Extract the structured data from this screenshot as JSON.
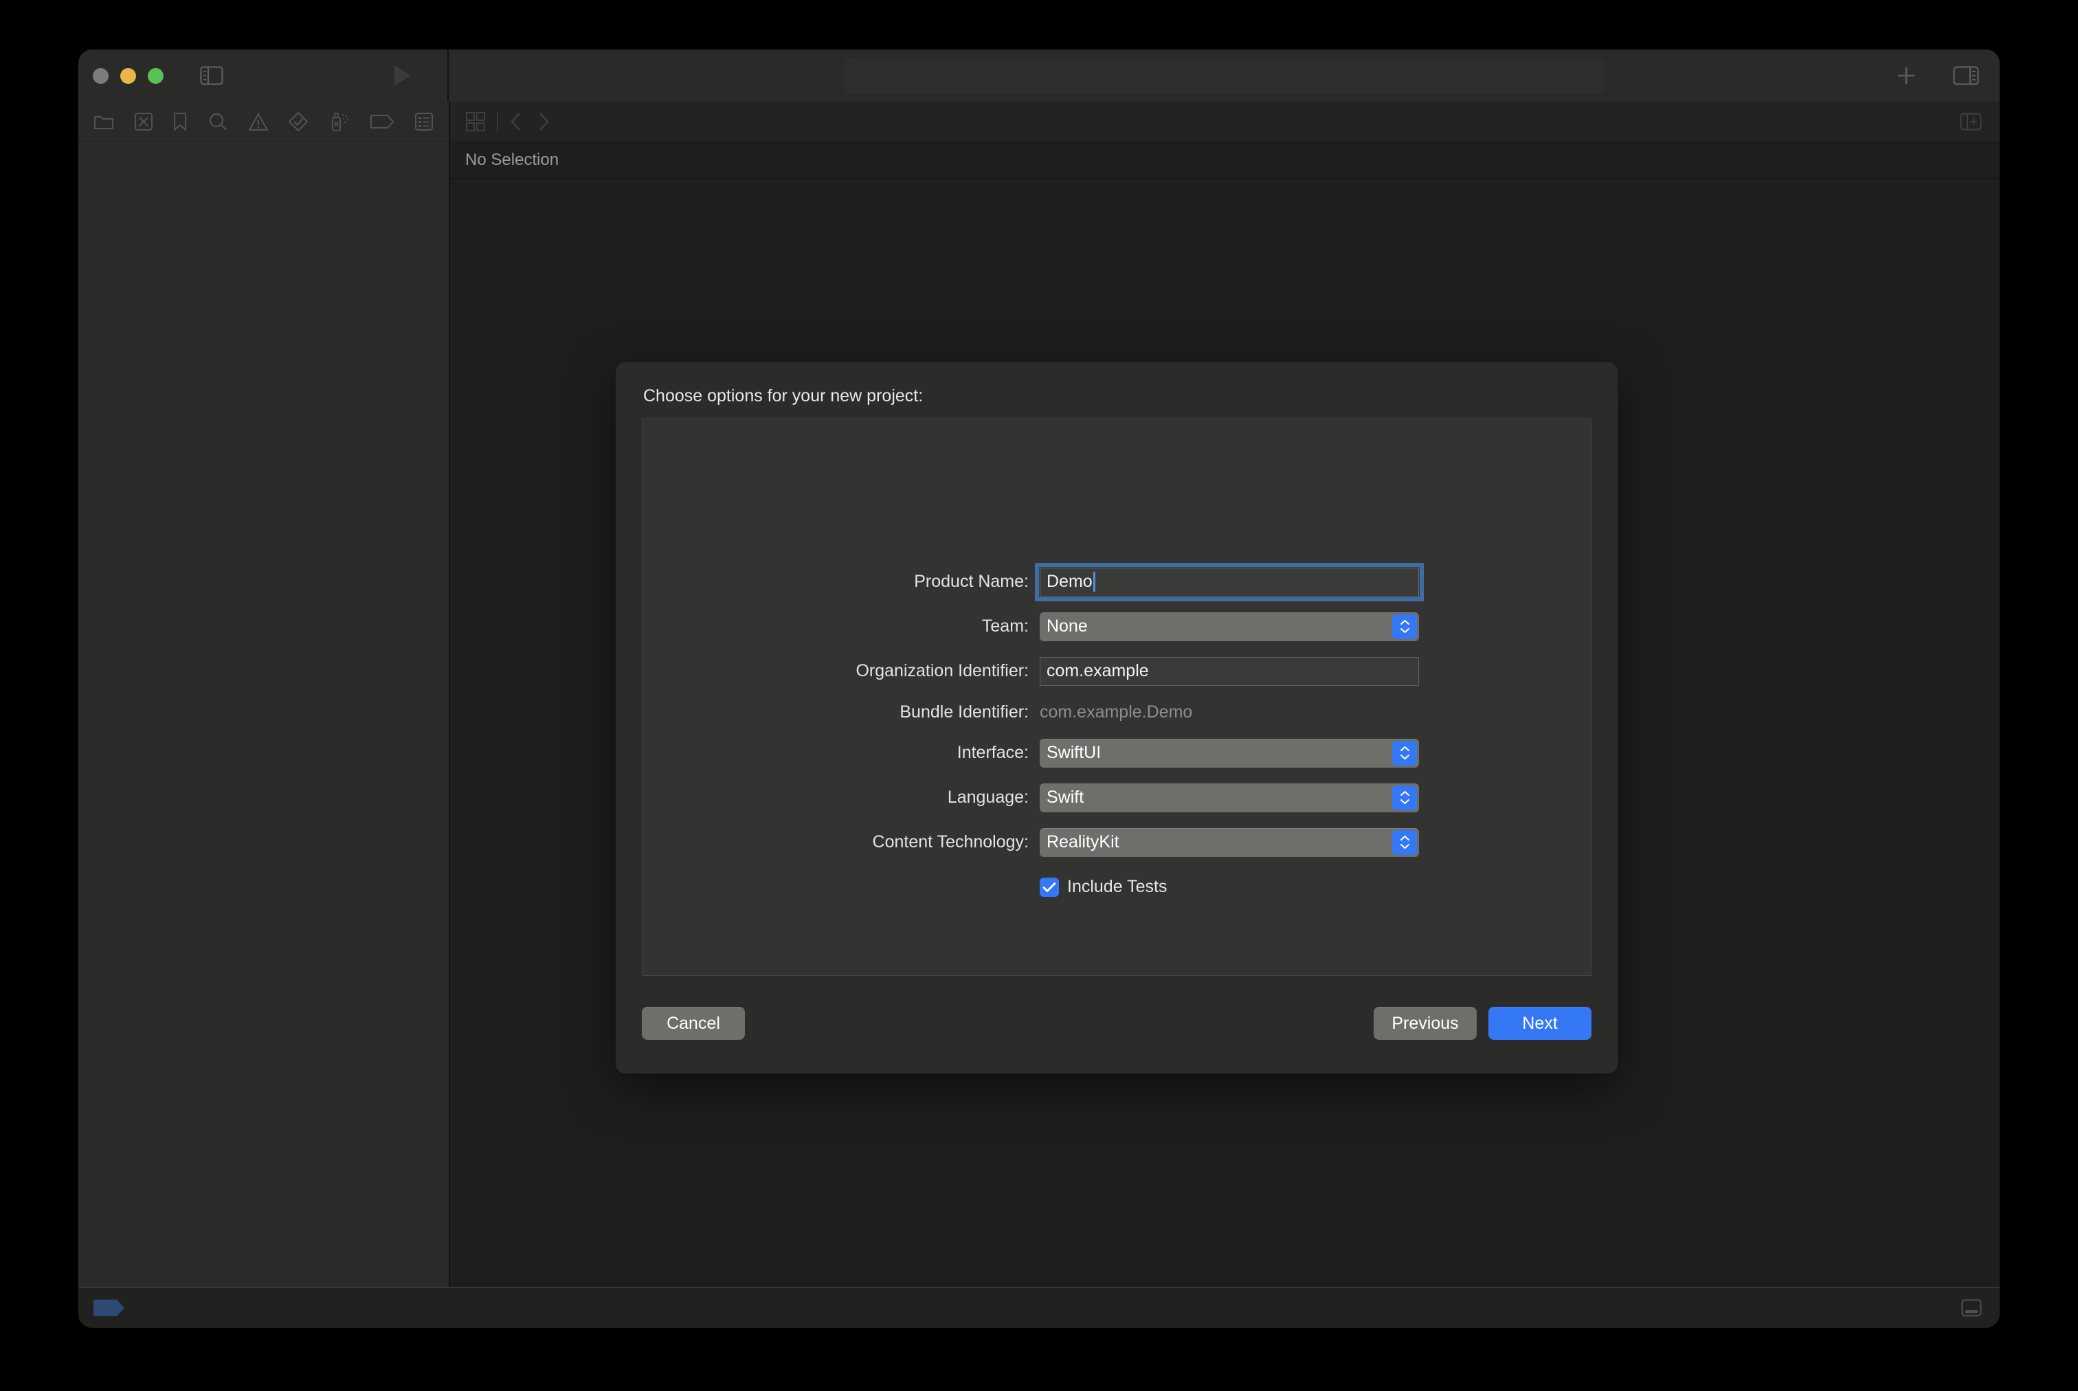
{
  "app": {
    "name": "Xcode",
    "accent_color": "#3478f6",
    "window_bg": "#1e1f1c",
    "sidebar_bg": "#2a2a28",
    "sheet_bg": "#2b2c29"
  },
  "titlebar": {
    "traffic_lights": [
      {
        "name": "close",
        "color": "#7c7c7a"
      },
      {
        "name": "minimize",
        "color": "#e9b64a"
      },
      {
        "name": "zoom",
        "color": "#5bbf54"
      }
    ],
    "sidebar_toggle_icon": "sidebar-left-icon",
    "run_icon": "run-play-icon",
    "activity_text": "",
    "add_icon": "plus-icon",
    "inspector_toggle_icon": "sidebar-right-icon"
  },
  "navigator": {
    "tabs": [
      {
        "icon": "folder-icon",
        "label": "Project navigator"
      },
      {
        "icon": "source-control-icon",
        "label": "Source control navigator"
      },
      {
        "icon": "bookmark-icon",
        "label": "Bookmark navigator"
      },
      {
        "icon": "search-icon",
        "label": "Find navigator"
      },
      {
        "icon": "warning-triangle-icon",
        "label": "Issue navigator"
      },
      {
        "icon": "test-diamond-icon",
        "label": "Test navigator"
      },
      {
        "icon": "debug-spray-icon",
        "label": "Debug navigator"
      },
      {
        "icon": "breakpoint-tag-icon",
        "label": "Breakpoint navigator"
      },
      {
        "icon": "report-list-icon",
        "label": "Report navigator"
      }
    ]
  },
  "editor": {
    "jumpbar": {
      "grid_icon": "related-items-grid-icon",
      "back_icon": "chevron-left-icon",
      "forward_icon": "chevron-right-icon",
      "add_editor_icon": "add-editor-icon"
    },
    "breadcrumb_text": "No Selection"
  },
  "statusbar": {
    "breakpoint_indicator": "breakpoint-tag-icon",
    "debug_area_toggle_icon": "debug-area-toggle-icon"
  },
  "sheet": {
    "title": "Choose options for your new project:",
    "fields": [
      {
        "key": "product_name",
        "label": "Product Name:",
        "type": "textfield",
        "value": "Demo",
        "placeholder": "",
        "focused": true
      },
      {
        "key": "team",
        "label": "Team:",
        "type": "popup",
        "value": "None"
      },
      {
        "key": "organization_identifier",
        "label": "Organization Identifier:",
        "type": "textfield",
        "value": "com.example",
        "placeholder": "",
        "focused": false
      },
      {
        "key": "bundle_identifier",
        "label": "Bundle Identifier:",
        "type": "static",
        "value": "com.example.Demo"
      },
      {
        "key": "interface",
        "label": "Interface:",
        "type": "popup",
        "value": "SwiftUI"
      },
      {
        "key": "language",
        "label": "Language:",
        "type": "popup",
        "value": "Swift"
      },
      {
        "key": "content_technology",
        "label": "Content Technology:",
        "type": "popup",
        "value": "RealityKit"
      }
    ],
    "include_tests": {
      "label": "Include Tests",
      "checked": true
    },
    "buttons": {
      "cancel": "Cancel",
      "previous": "Previous",
      "next": "Next"
    }
  }
}
